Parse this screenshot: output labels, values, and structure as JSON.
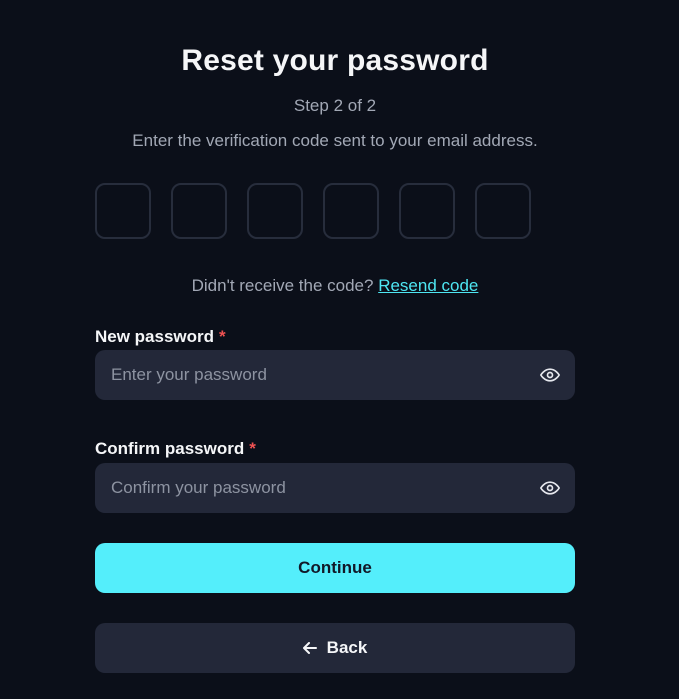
{
  "header": {
    "title": "Reset your password",
    "step": "Step 2 of 2",
    "subtitle": "Enter the verification code sent to your email address."
  },
  "code": {
    "digits": [
      "",
      "",
      "",
      "",
      "",
      ""
    ]
  },
  "resend": {
    "prompt": "Didn't receive the code?",
    "link": "Resend code"
  },
  "new_password": {
    "label": "New password",
    "required_mark": "*",
    "placeholder": "Enter your password",
    "value": "",
    "toggle_icon": "eye-icon"
  },
  "confirm_password": {
    "label": "Confirm password",
    "required_mark": "*",
    "placeholder": "Confirm your password",
    "value": "",
    "toggle_icon": "eye-icon"
  },
  "actions": {
    "continue_label": "Continue",
    "back_label": "Back",
    "back_icon": "arrow-left-icon"
  },
  "colors": {
    "background": "#0b0f19",
    "accent": "#54eefb",
    "field_bg": "#232839",
    "required": "#f05252",
    "link": "#4ee6f2"
  }
}
